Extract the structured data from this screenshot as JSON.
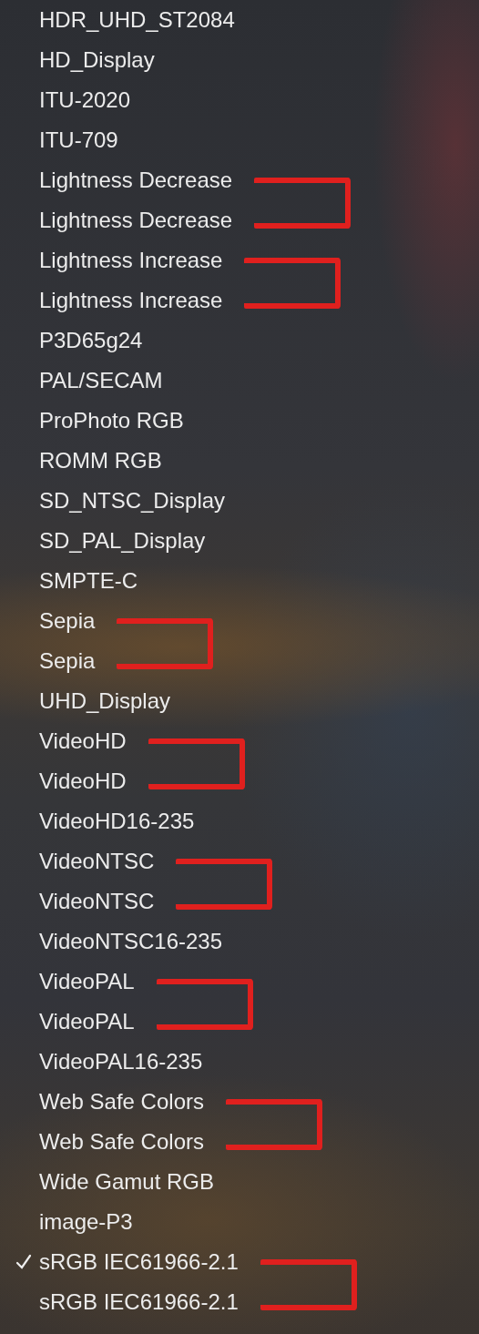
{
  "menu": {
    "items": [
      {
        "label": "HDR_UHD_ST2084",
        "selected": false,
        "bracket_start": false
      },
      {
        "label": "HD_Display",
        "selected": false,
        "bracket_start": false
      },
      {
        "label": "ITU-2020",
        "selected": false,
        "bracket_start": false
      },
      {
        "label": "ITU-709",
        "selected": false,
        "bracket_start": false
      },
      {
        "label": "Lightness Decrease",
        "selected": false,
        "bracket_start": true
      },
      {
        "label": "Lightness Decrease",
        "selected": false,
        "bracket_start": false
      },
      {
        "label": "Lightness Increase",
        "selected": false,
        "bracket_start": true
      },
      {
        "label": "Lightness Increase",
        "selected": false,
        "bracket_start": false
      },
      {
        "label": "P3D65g24",
        "selected": false,
        "bracket_start": false
      },
      {
        "label": "PAL/SECAM",
        "selected": false,
        "bracket_start": false
      },
      {
        "label": "ProPhoto RGB",
        "selected": false,
        "bracket_start": false
      },
      {
        "label": "ROMM RGB",
        "selected": false,
        "bracket_start": false
      },
      {
        "label": "SD_NTSC_Display",
        "selected": false,
        "bracket_start": false
      },
      {
        "label": "SD_PAL_Display",
        "selected": false,
        "bracket_start": false
      },
      {
        "label": "SMPTE-C",
        "selected": false,
        "bracket_start": false
      },
      {
        "label": "Sepia",
        "selected": false,
        "bracket_start": true
      },
      {
        "label": "Sepia",
        "selected": false,
        "bracket_start": false
      },
      {
        "label": "UHD_Display",
        "selected": false,
        "bracket_start": false
      },
      {
        "label": "VideoHD",
        "selected": false,
        "bracket_start": true
      },
      {
        "label": "VideoHD",
        "selected": false,
        "bracket_start": false
      },
      {
        "label": "VideoHD16-235",
        "selected": false,
        "bracket_start": false
      },
      {
        "label": "VideoNTSC",
        "selected": false,
        "bracket_start": true
      },
      {
        "label": "VideoNTSC",
        "selected": false,
        "bracket_start": false
      },
      {
        "label": "VideoNTSC16-235",
        "selected": false,
        "bracket_start": false
      },
      {
        "label": "VideoPAL",
        "selected": false,
        "bracket_start": true
      },
      {
        "label": "VideoPAL",
        "selected": false,
        "bracket_start": false
      },
      {
        "label": "VideoPAL16-235",
        "selected": false,
        "bracket_start": false
      },
      {
        "label": "Web Safe Colors",
        "selected": false,
        "bracket_start": true
      },
      {
        "label": "Web Safe Colors",
        "selected": false,
        "bracket_start": false
      },
      {
        "label": "Wide Gamut RGB",
        "selected": false,
        "bracket_start": false
      },
      {
        "label": "image-P3",
        "selected": false,
        "bracket_start": false
      },
      {
        "label": "sRGB IEC61966-2.1",
        "selected": true,
        "bracket_start": true
      },
      {
        "label": "sRGB IEC61966-2.1",
        "selected": false,
        "bracket_start": false
      }
    ]
  }
}
